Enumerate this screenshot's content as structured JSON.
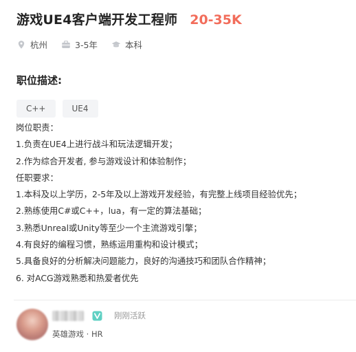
{
  "job": {
    "title": "游戏UE4客户端开发工程师",
    "salary": "20-35K",
    "location": "杭州",
    "experience": "3-5年",
    "education": "本科"
  },
  "section": {
    "title": "职位描述:"
  },
  "tags": [
    "C++",
    "UE4"
  ],
  "description": [
    "岗位职责：",
    "1.负责在UE4上进行战斗和玩法逻辑开发；",
    "2.作为综合开发者, 参与游戏设计和体验制作；",
    "任职要求：",
    "1.本科及以上学历，2-5年及以上游戏开发经验，有完整上线项目经验优先；",
    "2.熟练使用C#或C++，lua，有一定的算法基础；",
    "3.熟悉Unreal或Unity等至少一个主流游戏引擎；",
    "4.有良好的编程习惯，熟练运用重构和设计模式；",
    "5.具备良好的分析解决问题能力，良好的沟通技巧和团队合作精神；",
    "6. 对ACG游戏熟悉和热爱者优先"
  ],
  "recruiter": {
    "status": "刚刚活跃",
    "company_role": "英雄游戏 · HR"
  },
  "icons": {
    "location": "location-pin-icon",
    "experience": "briefcase-icon",
    "education": "graduation-cap-icon",
    "verified": "verified-badge-icon"
  },
  "colors": {
    "salary": "#f26d5b",
    "verified": "#5fd0c3"
  }
}
